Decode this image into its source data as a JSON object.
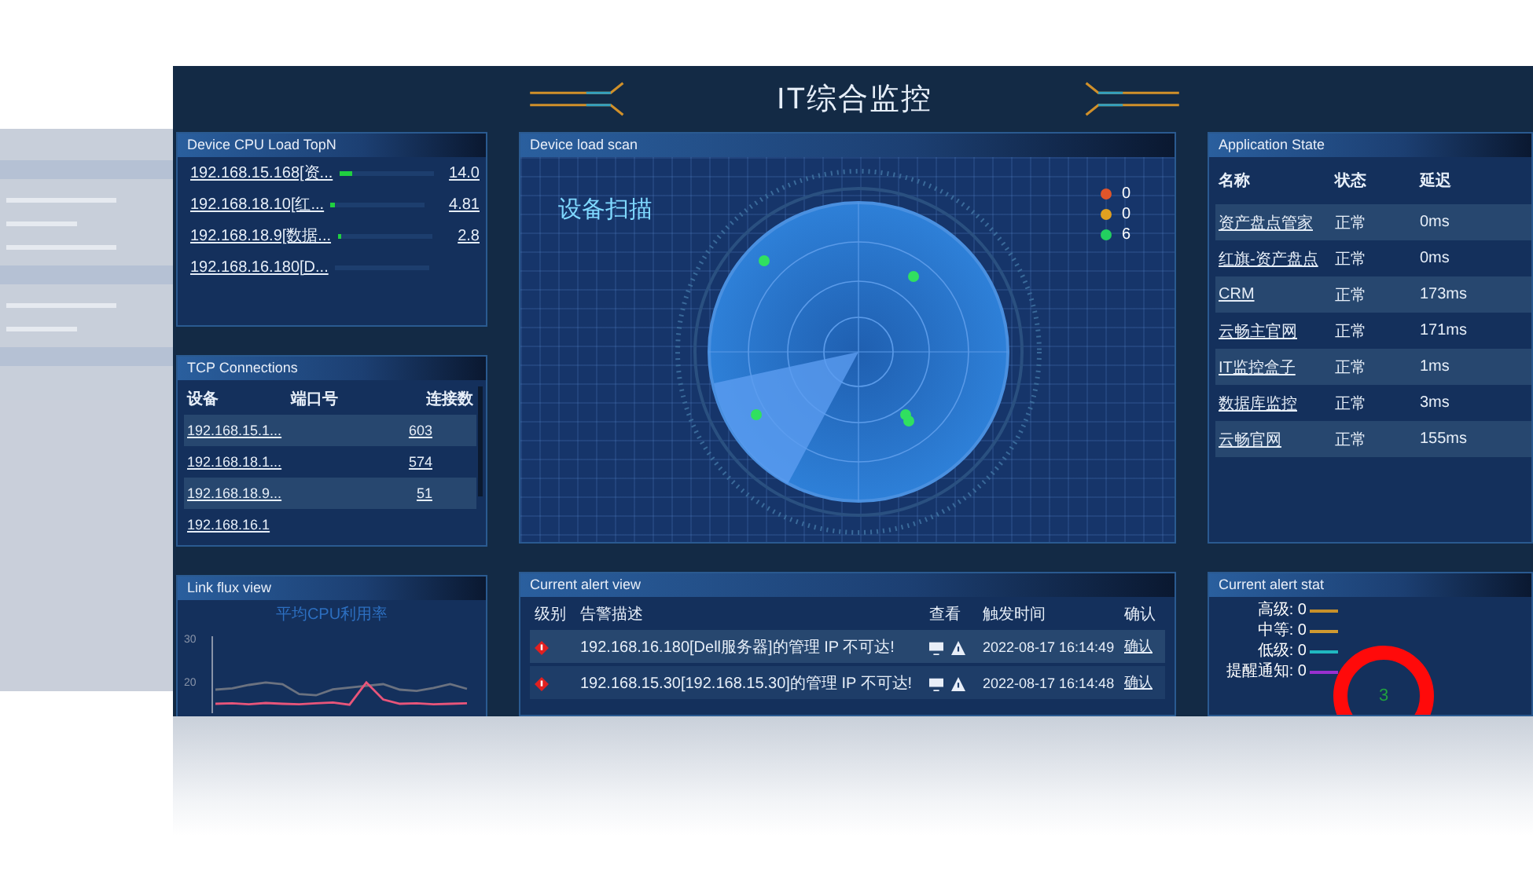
{
  "dashboard": {
    "title": "IT综合监控"
  },
  "cpu_panel": {
    "title": "Device CPU Load TopN",
    "rows": [
      {
        "device": "192.168.15.168[资...",
        "level": 0.14,
        "value": "14.0"
      },
      {
        "device": "192.168.18.10[红...",
        "level": 0.05,
        "value": "4.81"
      },
      {
        "device": "192.168.18.9[数据...",
        "level": 0.03,
        "value": "2.8"
      },
      {
        "device": "192.168.16.180[D..."
      }
    ]
  },
  "tcp_panel": {
    "title": "TCP Connections",
    "columns": [
      "设备",
      "端口号",
      "连接数"
    ],
    "rows": [
      {
        "device": "192.168.15.1...",
        "count": "603"
      },
      {
        "device": "192.168.18.1...",
        "count": "574"
      },
      {
        "device": "192.168.18.9...",
        "count": "51"
      },
      {
        "device": "192.168.16.1"
      }
    ]
  },
  "flux_panel": {
    "title": "Link flux view",
    "chart_data": {
      "type": "line",
      "title": "平均CPU利用率",
      "ylim": [
        13,
        31
      ],
      "yticks": [
        20,
        30
      ],
      "series": [
        {
          "color": "#6b7280",
          "values": [
            18.5,
            18.8,
            19.6,
            20.2,
            19.8,
            17.5,
            17.2,
            18.6,
            19.0,
            19.4,
            19.8,
            18.5,
            18.2,
            18.9,
            19.8,
            18.7
          ]
        },
        {
          "color": "#e8557a",
          "values": [
            15.2,
            15.3,
            15.1,
            15.4,
            15.2,
            15.1,
            15.3,
            15.5,
            15.0,
            20.2,
            16.2,
            15.2,
            15.3,
            15.1,
            15.2,
            15.3
          ]
        }
      ]
    }
  },
  "scan_panel": {
    "title": "Device load scan",
    "heading": "设备扫描",
    "legend": [
      {
        "color": "#e0552a",
        "count": "0"
      },
      {
        "color": "#e0a020",
        "count": "0"
      },
      {
        "color": "#22d060",
        "count": "6"
      }
    ]
  },
  "alert_panel": {
    "title": "Current alert view",
    "columns": [
      "级别",
      "告警描述",
      "查看",
      "触发时间",
      "确认"
    ],
    "rows": [
      {
        "description": "192.168.16.180[Dell服务器]的管理 IP 不可达!",
        "time": "2022-08-17 16:14:49",
        "action": "确认"
      },
      {
        "description": "192.168.15.30[192.168.15.30]的管理 IP 不可达!",
        "time": "2022-08-17 16:14:48",
        "action": "确认"
      }
    ]
  },
  "app_panel": {
    "title": "Application State",
    "columns": [
      "名称",
      "状态",
      "延迟"
    ],
    "rows": [
      {
        "name": "资产盘点管家",
        "state": "正常",
        "latency": "0ms"
      },
      {
        "name": "红旗-资产盘点",
        "state": "正常",
        "latency": "0ms"
      },
      {
        "name": "CRM",
        "state": "正常",
        "latency": "173ms"
      },
      {
        "name": "云畅主官网",
        "state": "正常",
        "latency": "171ms"
      },
      {
        "name": "IT监控盒子",
        "state": "正常",
        "latency": "1ms"
      },
      {
        "name": "数据库监控",
        "state": "正常",
        "latency": "3ms"
      },
      {
        "name": "云畅官网",
        "state": "正常",
        "latency": "155ms"
      }
    ]
  },
  "stat_panel": {
    "title": "Current alert stat",
    "labels": [
      {
        "text": "高级: 0",
        "color": "#c8902a"
      },
      {
        "text": "中等: 0",
        "color": "#d09a30"
      },
      {
        "text": "低级: 0",
        "color": "#20b8c0"
      },
      {
        "text": "提醒通知: 0",
        "color": "#9a30d0"
      }
    ],
    "total": "3"
  }
}
